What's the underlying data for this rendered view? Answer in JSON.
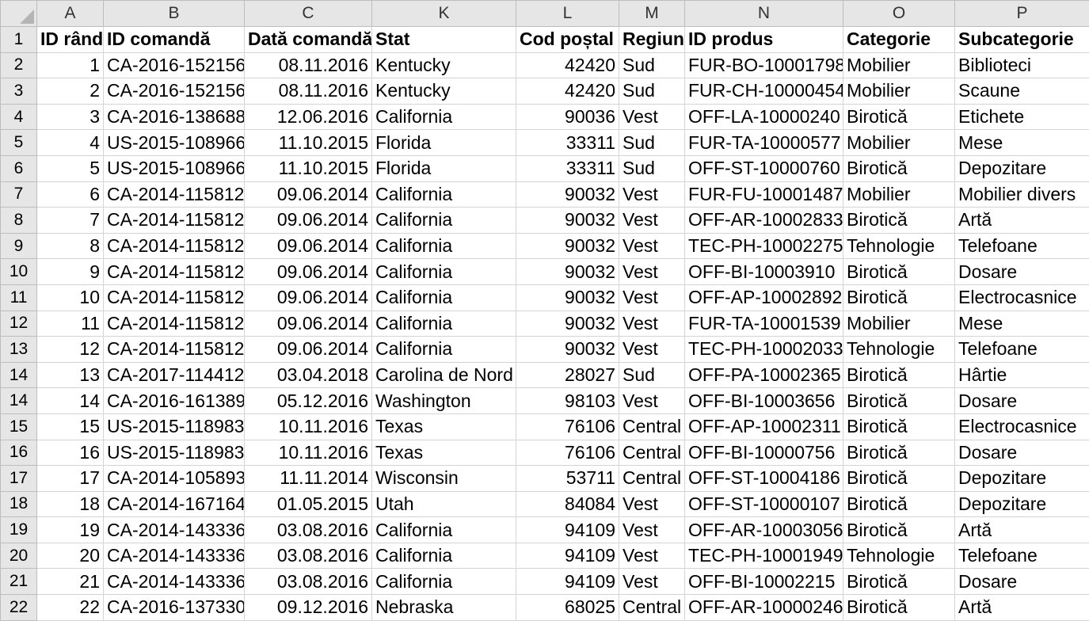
{
  "column_letters": [
    "A",
    "B",
    "C",
    "K",
    "L",
    "M",
    "N",
    "O",
    "P"
  ],
  "row_numbers": [
    "1",
    "2",
    "3",
    "4",
    "5",
    "6",
    "7",
    "8",
    "9",
    "10",
    "11",
    "12",
    "13",
    "14",
    "14",
    "15",
    "16",
    "17",
    "18",
    "19",
    "20",
    "21",
    "22"
  ],
  "headers": [
    "ID rând",
    "ID comandă",
    "Dată comandă",
    "Stat",
    "Cod poștal",
    "Regiune",
    "ID produs",
    "Categorie",
    "Subcategorie"
  ],
  "rows": [
    [
      "1",
      "CA-2016-152156",
      "08.11.2016",
      "Kentucky",
      "42420",
      "Sud",
      "FUR-BO-10001798",
      "Mobilier",
      "Biblioteci"
    ],
    [
      "2",
      "CA-2016-152156",
      "08.11.2016",
      "Kentucky",
      "42420",
      "Sud",
      "FUR-CH-10000454",
      "Mobilier",
      "Scaune"
    ],
    [
      "3",
      "CA-2016-138688",
      "12.06.2016",
      "California",
      "90036",
      "Vest",
      "OFF-LA-10000240",
      "Birotică",
      "Etichete"
    ],
    [
      "4",
      "US-2015-108966",
      "11.10.2015",
      "Florida",
      "33311",
      "Sud",
      "FUR-TA-10000577",
      "Mobilier",
      "Mese"
    ],
    [
      "5",
      "US-2015-108966",
      "11.10.2015",
      "Florida",
      "33311",
      "Sud",
      "OFF-ST-10000760",
      "Birotică",
      "Depozitare"
    ],
    [
      "6",
      "CA-2014-115812",
      "09.06.2014",
      "California",
      "90032",
      "Vest",
      "FUR-FU-10001487",
      "Mobilier",
      "Mobilier divers"
    ],
    [
      "7",
      "CA-2014-115812",
      "09.06.2014",
      "California",
      "90032",
      "Vest",
      "OFF-AR-10002833",
      "Birotică",
      "Artă"
    ],
    [
      "8",
      "CA-2014-115812",
      "09.06.2014",
      "California",
      "90032",
      "Vest",
      "TEC-PH-10002275",
      "Tehnologie",
      "Telefoane"
    ],
    [
      "9",
      "CA-2014-115812",
      "09.06.2014",
      "California",
      "90032",
      "Vest",
      "OFF-BI-10003910",
      "Birotică",
      "Dosare"
    ],
    [
      "10",
      "CA-2014-115812",
      "09.06.2014",
      "California",
      "90032",
      "Vest",
      "OFF-AP-10002892",
      "Birotică",
      "Electrocasnice"
    ],
    [
      "11",
      "CA-2014-115812",
      "09.06.2014",
      "California",
      "90032",
      "Vest",
      "FUR-TA-10001539",
      "Mobilier",
      "Mese"
    ],
    [
      "12",
      "CA-2014-115812",
      "09.06.2014",
      "California",
      "90032",
      "Vest",
      "TEC-PH-10002033",
      "Tehnologie",
      "Telefoane"
    ],
    [
      "13",
      "CA-2017-114412",
      "03.04.2018",
      "Carolina de Nord",
      "28027",
      "Sud",
      "OFF-PA-10002365",
      "Birotică",
      "Hârtie"
    ],
    [
      "14",
      "CA-2016-161389",
      "05.12.2016",
      "Washington",
      "98103",
      "Vest",
      "OFF-BI-10003656",
      "Birotică",
      "Dosare"
    ],
    [
      "15",
      "US-2015-118983",
      "10.11.2016",
      "Texas",
      "76106",
      "Central",
      "OFF-AP-10002311",
      "Birotică",
      "Electrocasnice"
    ],
    [
      "16",
      "US-2015-118983",
      "10.11.2016",
      "Texas",
      "76106",
      "Central",
      "OFF-BI-10000756",
      "Birotică",
      "Dosare"
    ],
    [
      "17",
      "CA-2014-105893",
      "11.11.2014",
      "Wisconsin",
      "53711",
      "Central",
      "OFF-ST-10004186",
      "Birotică",
      "Depozitare"
    ],
    [
      "18",
      "CA-2014-167164",
      "01.05.2015",
      "Utah",
      "84084",
      "Vest",
      "OFF-ST-10000107",
      "Birotică",
      "Depozitare"
    ],
    [
      "19",
      "CA-2014-143336",
      "03.08.2016",
      "California",
      "94109",
      "Vest",
      "OFF-AR-10003056",
      "Birotică",
      "Artă"
    ],
    [
      "20",
      "CA-2014-143336",
      "03.08.2016",
      "California",
      "94109",
      "Vest",
      "TEC-PH-10001949",
      "Tehnologie",
      "Telefoane"
    ],
    [
      "21",
      "CA-2014-143336",
      "03.08.2016",
      "California",
      "94109",
      "Vest",
      "OFF-BI-10002215",
      "Birotică",
      "Dosare"
    ],
    [
      "22",
      "CA-2016-137330",
      "09.12.2016",
      "Nebraska",
      "68025",
      "Central",
      "OFF-AR-10000246",
      "Birotică",
      "Artă"
    ]
  ],
  "select_all_icon": "select-all-triangle-icon",
  "colors": {
    "header_bg": "#e6e6e6",
    "gridline": "#d4d4d4",
    "header_border": "#bdbdbd",
    "text": "#000000"
  }
}
